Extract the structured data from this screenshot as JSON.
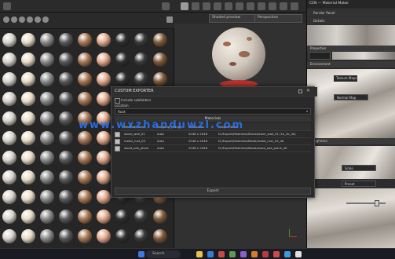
{
  "viewport": {
    "shading_dropdown": "Shaded preview",
    "camera_dropdown": "Perspective"
  },
  "dialog": {
    "title": "CUSTOM EXPORTER",
    "checkbox_label": "Include subfolders",
    "location_label": "Location",
    "location_value": "Root",
    "section_materials": "Materials",
    "export_button": "Export",
    "columns": [
      "Material name",
      "Mapping (Tiling)",
      "Resolution",
      "Output folder"
    ],
    "rows": [
      {
        "name": "stone_wall_01",
        "mapping": "Auto",
        "resolution": "2048 x 2048",
        "folder": "D:/Export/Materials/Stone/stone_wall_01 (1k_2k_4k)"
      },
      {
        "name": "metal_rust_03",
        "mapping": "Auto",
        "resolution": "2048 x 2048",
        "folder": "D:/Export/Materials/Metal/metal_rust_03_4K"
      },
      {
        "name": "wood_oak_plank",
        "mapping": "Auto",
        "resolution": "2048 x 2048",
        "folder": "D:/Export/Materials/Wood/wood_oak_plank_4K"
      }
    ]
  },
  "right_panel": {
    "top_title": "CEN — Material Maker",
    "header_a": "Render Panel",
    "header_b": "Details",
    "label_a": "Properties",
    "label_b": "Environment",
    "section_c": "Texture Maps",
    "label_c": "Normal Map",
    "label_d": "Roughness",
    "field_e": "Scale",
    "field_f": "Preset"
  },
  "watermark": "www.wxzhanduwzl.com",
  "taskbar": {
    "search_placeholder": "Search"
  },
  "colors": {
    "accent_red": "#b8332e",
    "window_bg": "#2a2a2a",
    "watermark": "#2878ff"
  }
}
